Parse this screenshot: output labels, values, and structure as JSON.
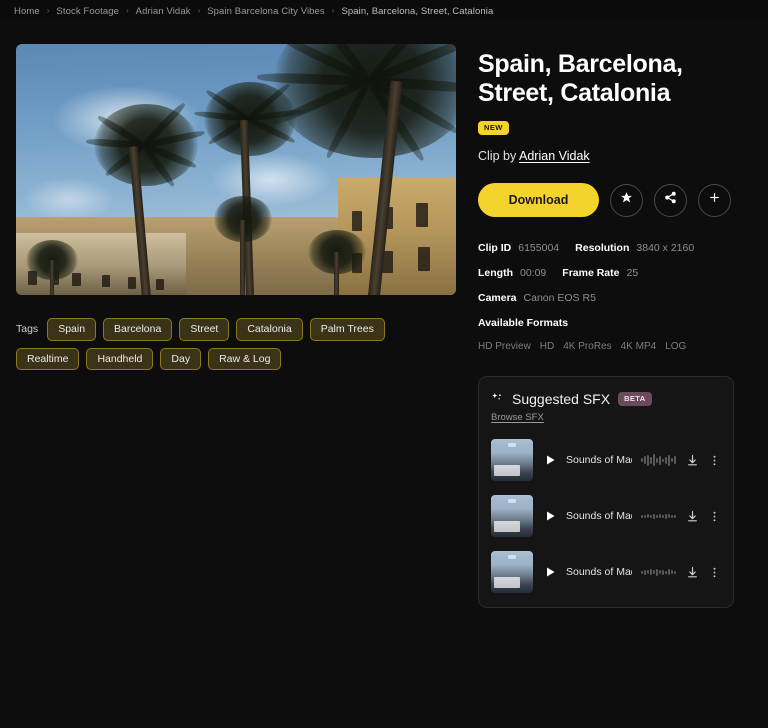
{
  "breadcrumb": {
    "separator": "›",
    "items": [
      "Home",
      "Stock Footage",
      "Adrian Vidak",
      "Spain Barcelona City Vibes",
      "Spain, Barcelona, Street, Catalonia"
    ]
  },
  "video": {
    "alt": "Palm trees against blue sky, Barcelona street"
  },
  "tags": {
    "label": "Tags",
    "items": [
      "Spain",
      "Barcelona",
      "Street",
      "Catalonia",
      "Palm Trees",
      "Realtime",
      "Handheld",
      "Day",
      "Raw & Log"
    ]
  },
  "detail": {
    "title": "Spain, Barcelona, Street, Catalonia",
    "badge": "NEW",
    "clip_by_prefix": "Clip by",
    "author": "Adrian Vidak",
    "download_label": "Download",
    "icons": {
      "favorite": "★",
      "share": "share-icon",
      "add": "+"
    }
  },
  "meta": {
    "rows": [
      [
        {
          "label": "Clip ID",
          "value": "6155004"
        },
        {
          "label": "Resolution",
          "value": "3840 x 2160"
        }
      ],
      [
        {
          "label": "Length",
          "value": "00:09"
        },
        {
          "label": "Frame Rate",
          "value": "25"
        }
      ],
      [
        {
          "label": "Camera",
          "value": "Canon EOS R5"
        }
      ]
    ]
  },
  "formats": {
    "title": "Available Formats",
    "items": [
      "HD Preview",
      "HD",
      "4K ProRes",
      "4K MP4",
      "LOG"
    ]
  },
  "sfx": {
    "title": "Suggested SFX",
    "badge": "BETA",
    "browse_label": "Browse SFX",
    "tracks": [
      {
        "name": "Sounds of Madrid",
        "thumb_title": "Sounds of Madrid"
      },
      {
        "name": "Sounds of Madrid",
        "thumb_title": "Sounds of Madrid"
      },
      {
        "name": "Sounds of Madrid",
        "thumb_title": "Sounds of Madrid"
      }
    ]
  },
  "colors": {
    "accent": "#F5D32D",
    "page_bg": "#0d0d0d",
    "panel_bg": "#151515",
    "tag_border": "#8a7a1e",
    "beta_badge": "#6B4A5E"
  }
}
